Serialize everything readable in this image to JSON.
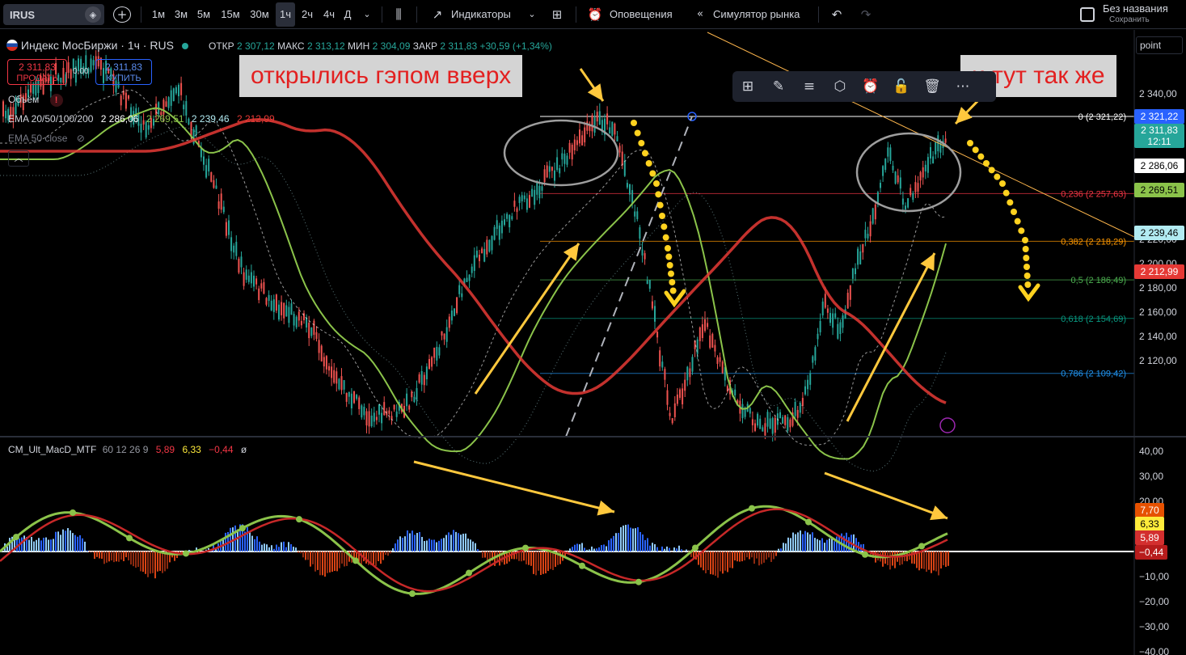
{
  "toolbar": {
    "symbol": "IRUS",
    "timeframes": [
      "1м",
      "3м",
      "5м",
      "15м",
      "30м",
      "1ч",
      "2ч",
      "4ч",
      "Д"
    ],
    "active_timeframe": "1ч",
    "indicators_label": "Индикаторы",
    "alerts_label": "Оповещения",
    "replay_label": "Симулятор рынка",
    "layout_name": "Без названия",
    "save_label": "Сохранить"
  },
  "legend": {
    "title": "Индекс МосБиржи · 1ч · RUS",
    "ohlc": {
      "open_label": "ОТКР",
      "open": "2 307,12",
      "high_label": "МАКС",
      "high": "2 313,12",
      "low_label": "МИН",
      "low": "2 304,09",
      "close_label": "ЗАКР",
      "close": "2 311,83",
      "change": "+30,59 (+1,34%)"
    },
    "sell_price": "2 311,83",
    "sell_label": "ПРОДАТЬ",
    "spread": "0,00",
    "buy_price": "2 311,83",
    "buy_label": "КУПИТЬ",
    "volume_label": "Объём",
    "ema_label": "EMA 20/50/100/200",
    "ema_values": [
      "2 286,06",
      "2 269,51",
      "2 239,46",
      "2 212,99"
    ],
    "ema50_label": "EMA 50 close"
  },
  "annotations": {
    "gap_up": "открылись гэпом вверх",
    "same_here": "и тут так же"
  },
  "price_axis": {
    "ticks": [
      "2 340,00",
      "2 260,00",
      "2 220,00",
      "2 200,00",
      "2 180,00",
      "2 160,00",
      "2 140,00",
      "2 120,00"
    ],
    "labels": [
      {
        "text": "2 321,22",
        "bg": "#2962ff",
        "color": "#ffffff"
      },
      {
        "text": "2 311,83",
        "sub": "12:11",
        "bg": "#26a69a",
        "color": "#ffffff"
      },
      {
        "text": "2 286,06",
        "bg": "#ffffff",
        "color": "#000000"
      },
      {
        "text": "2 269,51",
        "bg": "#8bc34a",
        "color": "#000000"
      },
      {
        "text": "2 239,46",
        "bg": "#b2ebf2",
        "color": "#000000"
      },
      {
        "text": "2 212,99",
        "bg": "#e53935",
        "color": "#ffffff"
      }
    ],
    "scale_mode": "point"
  },
  "fib_levels": [
    {
      "label": "0 (2 321,22)",
      "color": "#ffffff"
    },
    {
      "label": "0,236 (2 257,63)",
      "color": "#f23645"
    },
    {
      "label": "0,382 (2 218,29)",
      "color": "#ff9800"
    },
    {
      "label": "0,5 (2 186,49)",
      "color": "#4caf50"
    },
    {
      "label": "0,618 (2 154,69)",
      "color": "#089981"
    },
    {
      "label": "0,786 (2 109,42)",
      "color": "#2196f3"
    }
  ],
  "macd": {
    "name": "CM_Ult_MacD_MTF",
    "params": "60 12 26 9",
    "values": [
      "5,89",
      "6,33",
      "−0,44"
    ],
    "value_colors": [
      "#f23645",
      "#ffeb3b",
      "#f23645"
    ],
    "extra": "ø",
    "ticks": [
      "40,00",
      "30,00",
      "20,00",
      "−10,00",
      "−20,00",
      "−30,00",
      "−40,00"
    ],
    "labels": [
      {
        "text": "7,70",
        "bg": "#e65100",
        "color": "#ffffff"
      },
      {
        "text": "6,33",
        "bg": "#ffeb3b",
        "color": "#000000"
      },
      {
        "text": "5,89",
        "bg": "#d32f2f",
        "color": "#ffffff"
      },
      {
        "text": "−0,44",
        "bg": "#b71c1c",
        "color": "#ffffff"
      }
    ]
  },
  "colors": {
    "ema20": "#ffffff",
    "ema50": "#8bc34a",
    "ema100": "#b2ebf2",
    "ema200": "#e53935",
    "arrow": "#ffc83d",
    "dots": "#ffd21f",
    "fib_line": "#ffb74d",
    "hist_pos": "#2962ff",
    "hist_neg": "#d84315"
  }
}
